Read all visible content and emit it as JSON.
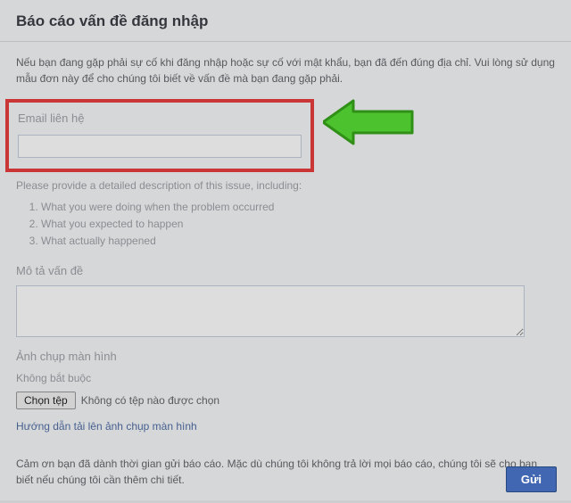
{
  "header": {
    "title": "Báo cáo vấn đề đăng nhập"
  },
  "intro": "Nếu bạn đang gặp phải sự cố khi đăng nhập hoặc sự cố với mật khẩu, bạn đã đến đúng địa chỉ. Vui lòng sử dụng mẫu đơn này để cho chúng tôi biết về vấn đề mà bạn đang gặp phải.",
  "email": {
    "label": "Email liên hệ",
    "value": ""
  },
  "detail_prompt": "Please provide a detailed description of this issue, including:",
  "detail_items": [
    "What you were doing when the problem occurred",
    "What you expected to happen",
    "What actually happened"
  ],
  "describe": {
    "label": "Mô tả vấn đề",
    "value": ""
  },
  "screenshot": {
    "label": "Ảnh chụp màn hình",
    "optional": "Không bắt buộc",
    "button": "Chọn tệp",
    "status": "Không có tệp nào được chọn",
    "guide_link": "Hướng dẫn tải lên ảnh chụp màn hình"
  },
  "thanks": "Cảm ơn bạn đã dành thời gian gửi báo cáo. Mặc dù chúng tôi không trả lời mọi báo cáo, chúng tôi sẽ cho bạn biết nếu chúng tôi cần thêm chi tiết.",
  "submit": "Gửi"
}
